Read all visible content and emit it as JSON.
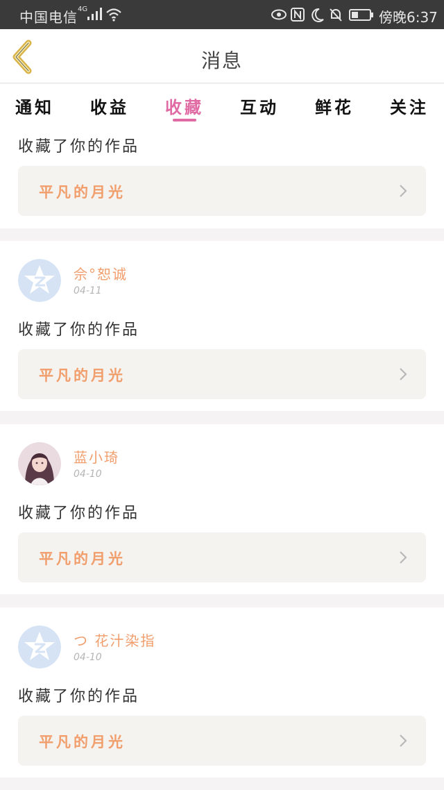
{
  "status_bar": {
    "carrier": "中国电信",
    "network": "4G",
    "time": "傍晚6:37"
  },
  "header": {
    "title": "消息"
  },
  "tabs": [
    {
      "label": "通知",
      "active": false
    },
    {
      "label": "收益",
      "active": false
    },
    {
      "label": "收藏",
      "active": true
    },
    {
      "label": "互动",
      "active": false
    },
    {
      "label": "鲜花",
      "active": false
    },
    {
      "label": "关注",
      "active": false
    }
  ],
  "messages": [
    {
      "action": "收藏了你的作品",
      "work": "平凡的月光"
    },
    {
      "user": "佘°恕诚",
      "date": "04-11",
      "avatar": "qzone-star-icon",
      "action": "收藏了你的作品",
      "work": "平凡的月光"
    },
    {
      "user": "蓝小琦",
      "date": "04-10",
      "avatar": "user-photo",
      "action": "收藏了你的作品",
      "work": "平凡的月光"
    },
    {
      "user": "つ 花汁染指",
      "date": "04-10",
      "avatar": "qzone-star-icon",
      "action": "收藏了你的作品",
      "work": "平凡的月光"
    }
  ],
  "colors": {
    "accent": "#e06aa3",
    "username": "#f19d6c",
    "work_box": "#f4f3ef",
    "status_bar": "#3a3a3a"
  }
}
